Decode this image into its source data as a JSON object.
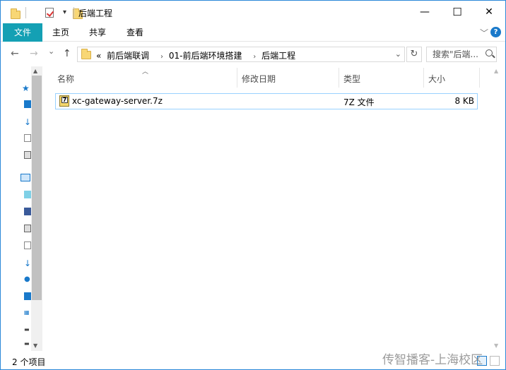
{
  "window": {
    "title": "后端工程",
    "minimize_glyph": "—",
    "maximize_glyph": "☐",
    "close_glyph": "✕"
  },
  "ribbon": {
    "tabs": [
      {
        "label": "文件",
        "active": true
      },
      {
        "label": "主页",
        "active": false
      },
      {
        "label": "共享",
        "active": false
      },
      {
        "label": "查看",
        "active": false
      }
    ],
    "expand_glyph": "﹀",
    "help_glyph": "?"
  },
  "nav": {
    "back_glyph": "←",
    "forward_glyph": "→",
    "recent_glyph": "⌄",
    "up_glyph": "↑",
    "overflow": "«",
    "breadcrumbs": [
      "前后端联调",
      "01-前后端环境搭建",
      "后端工程"
    ],
    "crumb_separator": "›",
    "refresh_glyph": "↻",
    "search_placeholder": "搜索\"后端..."
  },
  "columns": {
    "name": "名称",
    "modified": "修改日期",
    "type": "类型",
    "size": "大小"
  },
  "files": [
    {
      "name": "xc-gateway-server.7z",
      "modified": "",
      "type": "7Z 文件",
      "size": "8 KB",
      "icon_label": "7"
    }
  ],
  "status": {
    "item_count": "2 个项目"
  },
  "watermark": "传智播客-上海校区",
  "colors": {
    "accent": "#1979ca",
    "file_tab": "#14a0b4",
    "selection_border": "#99d1ff",
    "folder": "#f8d775"
  }
}
